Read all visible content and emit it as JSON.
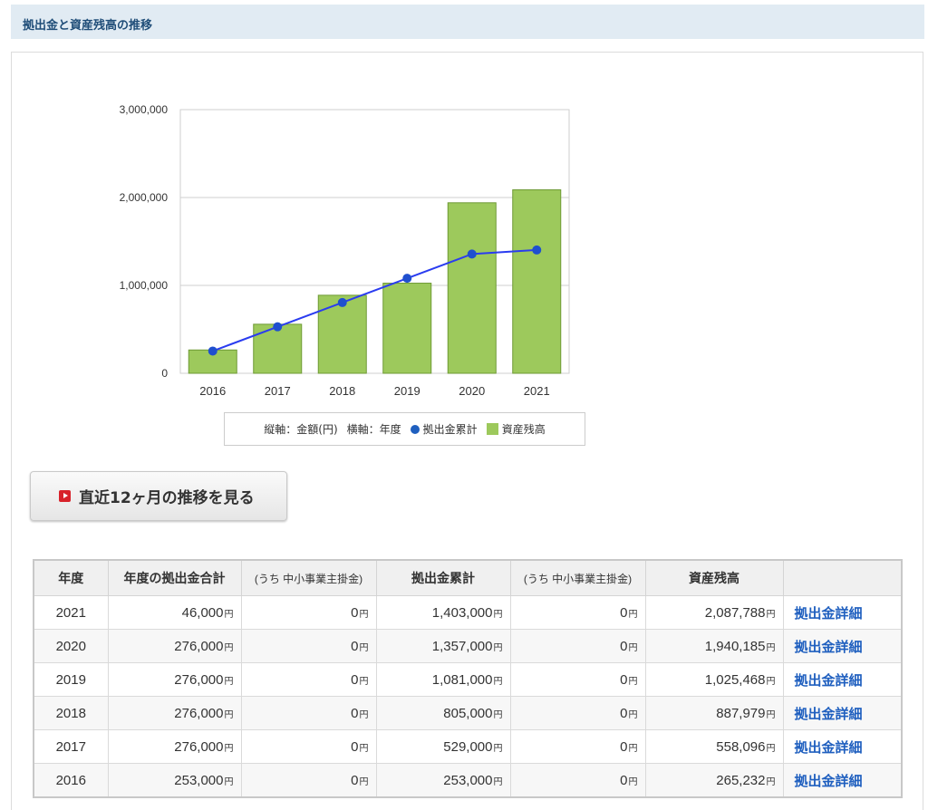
{
  "header": {
    "title": "拠出金と資産残高の推移"
  },
  "colors": {
    "bar": "#9dc95c",
    "bar_stroke": "#6e9a35",
    "line": "#2a3cf0",
    "marker": "#1f4fcf",
    "link": "#1f5fbf",
    "header_bg": "#e1ebf3"
  },
  "chart_data": {
    "type": "bar",
    "categories": [
      "2016",
      "2017",
      "2018",
      "2019",
      "2020",
      "2021"
    ],
    "series": [
      {
        "name": "資産残高",
        "type": "bar",
        "values": [
          265232,
          558096,
          887979,
          1025468,
          1940185,
          2087788
        ]
      },
      {
        "name": "拠出金累計",
        "type": "line",
        "values": [
          253000,
          529000,
          805000,
          1081000,
          1357000,
          1403000
        ]
      }
    ],
    "ylim": [
      0,
      3000000
    ],
    "yticks": [
      0,
      1000000,
      2000000,
      3000000
    ],
    "ytick_labels": [
      "0",
      "1,000,000",
      "2,000,000",
      "3,000,000"
    ],
    "grid": true,
    "legend": {
      "position": "bottom",
      "y_axis_note": "縦軸：金額(円)",
      "x_axis_note": "横軸：年度",
      "line_label": "拠出金累計",
      "bar_label": "資産残高"
    }
  },
  "recent_button": {
    "label": "直近12ヶ月の推移を見る"
  },
  "table": {
    "headers": [
      "年度",
      "年度の拠出金合計",
      "(うち 中小事業主掛金)",
      "拠出金累計",
      "(うち 中小事業主掛金)",
      "資産残高",
      ""
    ],
    "unit": "円",
    "rows": [
      {
        "year": "2021",
        "annual": "46,000",
        "annual_sme": "0",
        "cumulative": "1,403,000",
        "cumulative_sme": "0",
        "balance": "2,087,788",
        "link": "拠出金詳細"
      },
      {
        "year": "2020",
        "annual": "276,000",
        "annual_sme": "0",
        "cumulative": "1,357,000",
        "cumulative_sme": "0",
        "balance": "1,940,185",
        "link": "拠出金詳細"
      },
      {
        "year": "2019",
        "annual": "276,000",
        "annual_sme": "0",
        "cumulative": "1,081,000",
        "cumulative_sme": "0",
        "balance": "1,025,468",
        "link": "拠出金詳細"
      },
      {
        "year": "2018",
        "annual": "276,000",
        "annual_sme": "0",
        "cumulative": "805,000",
        "cumulative_sme": "0",
        "balance": "887,979",
        "link": "拠出金詳細"
      },
      {
        "year": "2017",
        "annual": "276,000",
        "annual_sme": "0",
        "cumulative": "529,000",
        "cumulative_sme": "0",
        "balance": "558,096",
        "link": "拠出金詳細"
      },
      {
        "year": "2016",
        "annual": "253,000",
        "annual_sme": "0",
        "cumulative": "253,000",
        "cumulative_sme": "0",
        "balance": "265,232",
        "link": "拠出金詳細"
      }
    ]
  }
}
